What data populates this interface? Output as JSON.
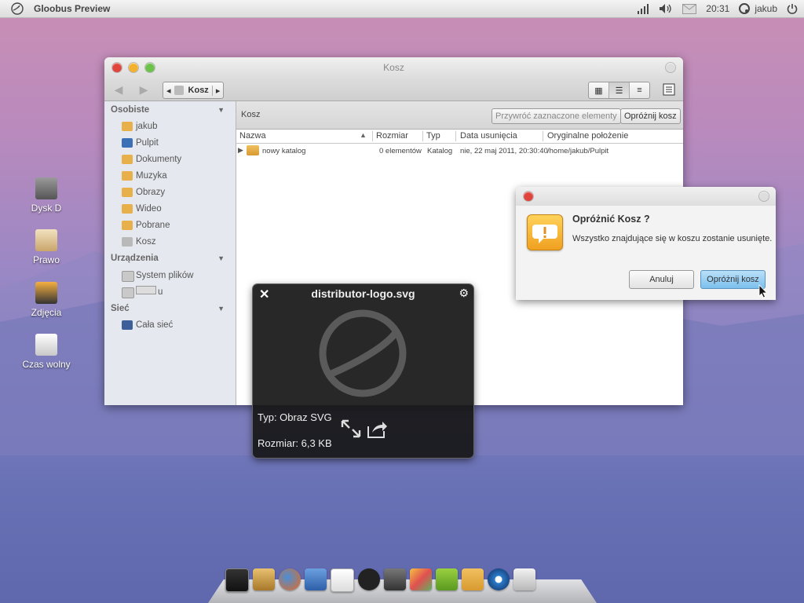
{
  "topbar": {
    "app_title": "Gloobus Preview",
    "time": "20:31",
    "user": "jakub"
  },
  "desktop": {
    "icons": [
      {
        "label": "Dysk D"
      },
      {
        "label": "Prawo"
      },
      {
        "label": "Zdjęcia"
      },
      {
        "label": "Czas wolny"
      }
    ]
  },
  "file_manager": {
    "title": "Kosz",
    "breadcrumb": "Kosz",
    "sidebar": {
      "sections": [
        {
          "header": "Osobiste",
          "items": [
            "jakub",
            "Pulpit",
            "Dokumenty",
            "Muzyka",
            "Obrazy",
            "Wideo",
            "Pobrane",
            "Kosz"
          ]
        },
        {
          "header": "Urządzenia",
          "items": [
            "System plików",
            "u"
          ]
        },
        {
          "header": "Sieć",
          "items": [
            "Cała sieć"
          ]
        }
      ]
    },
    "location_label": "Kosz",
    "restore_button": "Przywróć zaznaczone elementy",
    "empty_button": "Opróżnij kosz",
    "columns": [
      "Nazwa",
      "Rozmiar",
      "Typ",
      "Data usunięcia",
      "Oryginalne położenie"
    ],
    "rows": [
      {
        "name": "nowy katalog",
        "size": "0 elementów",
        "type": "Katalog",
        "deleted": "nie, 22 maj 2011, 20:30:40",
        "original": "/home/jakub/Pulpit"
      }
    ]
  },
  "dialog": {
    "heading": "Opróżnić Kosz ?",
    "message": "Wszystko znajdujące się w koszu zostanie usunięte.",
    "cancel_label": "Anuluj",
    "confirm_label": "Opróżnij kosz"
  },
  "preview": {
    "filename": "distributor-logo.svg",
    "type_line": "Typ: Obraz SVG",
    "size_line": "Rozmiar: 6,3 KB"
  },
  "colors": {
    "accent_blue": "#7cc0ee",
    "warning": "#f0a020",
    "close_red": "#e0443c"
  }
}
